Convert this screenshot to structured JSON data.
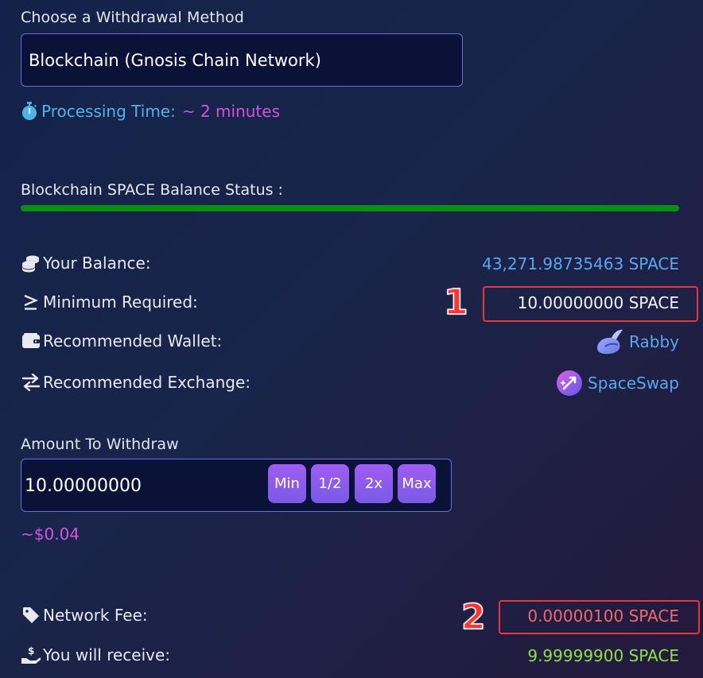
{
  "withdrawal": {
    "label": "Choose a Withdrawal Method",
    "method": "Blockchain (Gnosis Chain Network)",
    "processing_label": "Processing Time:",
    "processing_value": "~ 2 minutes"
  },
  "status": {
    "title": "Blockchain SPACE Balance Status :",
    "bar_color": "#0b8e12",
    "bar_fill": 1.0
  },
  "details": {
    "balance_label": "Your Balance:",
    "balance_value": "43,271.98735463 SPACE",
    "minimum_label": "Minimum Required:",
    "minimum_value": "10.00000000 SPACE",
    "wallet_label": "Recommended Wallet:",
    "wallet_value": "Rabby",
    "exchange_label": "Recommended Exchange:",
    "exchange_value": "SpaceSwap"
  },
  "amount": {
    "label": "Amount To Withdraw",
    "value": "10.00000000",
    "buttons": [
      "Min",
      "1/2",
      "2x",
      "Max"
    ],
    "usd": "~$0.04"
  },
  "fees": {
    "fee_label": "Network Fee:",
    "fee_value": "0.00000100 SPACE",
    "receive_label": "You will receive:",
    "receive_value": "9.99999900 SPACE"
  },
  "annotations": [
    "1",
    "2"
  ],
  "colors": {
    "accent_blue": "#5aa6f0",
    "accent_pink": "#d452e0",
    "fee_red": "#ef6a6a",
    "receive_green": "#8ee04a",
    "annotation_red": "#e23a3a"
  }
}
